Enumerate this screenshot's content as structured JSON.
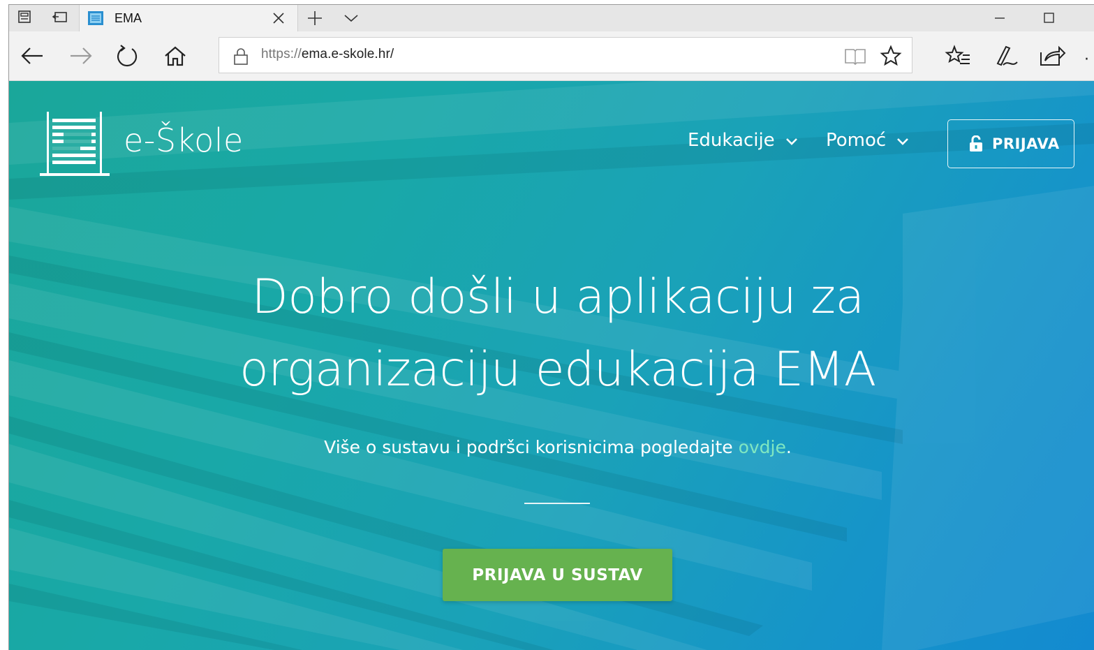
{
  "browser": {
    "tab_title": "EMA",
    "url_scheme": "https://",
    "url_host": "ema.e-skole.hr/"
  },
  "site": {
    "logo_text": "e-Škole",
    "nav": [
      {
        "label": "Edukacije"
      },
      {
        "label": "Pomoć"
      }
    ],
    "login_label": "PRIJAVA"
  },
  "hero": {
    "title_line1": "Dobro došli u aplikaciju za",
    "title_line2": "organizaciju edukacija EMA",
    "subtitle_text": "Više o sustavu i podršci korisnicima pogledajte ",
    "subtitle_link": "ovdje",
    "subtitle_end": ".",
    "cta_label": "PRIJAVA U SUSTAV"
  },
  "colors": {
    "accent_green": "#66b24f",
    "link_green": "#7fe7c1",
    "page_teal": "#1aa79a",
    "page_blue": "#138ad0"
  }
}
